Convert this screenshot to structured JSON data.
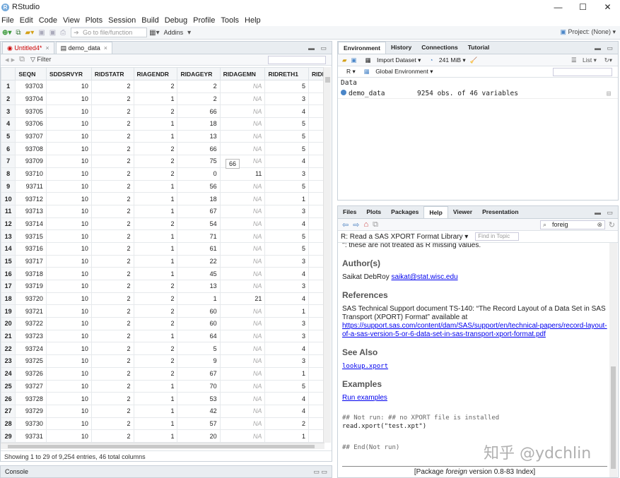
{
  "titlebar": {
    "title": "RStudio",
    "min": "—",
    "max": "☐",
    "close": "✕"
  },
  "menu": [
    "File",
    "Edit",
    "Code",
    "View",
    "Plots",
    "Session",
    "Build",
    "Debug",
    "Profile",
    "Tools",
    "Help"
  ],
  "toolbar": {
    "goto_placeholder": "Go to file/function",
    "addins": "Addins",
    "project": "Project: (None)"
  },
  "editor": {
    "tabs": [
      {
        "label": "Untitled4*",
        "active": false
      },
      {
        "label": "demo_data",
        "active": true
      }
    ],
    "filter": "Filter",
    "tooltip": "66",
    "columns": [
      "",
      "SEQN",
      "SDDSRVYR",
      "RIDSTATR",
      "RIAGENDR",
      "RIDAGEYR",
      "RIDAGEMN",
      "RIDRETH1",
      "RIDI"
    ],
    "rows": [
      [
        "1",
        "93703",
        "10",
        "2",
        "2",
        "2",
        "NA",
        "5"
      ],
      [
        "2",
        "93704",
        "10",
        "2",
        "1",
        "2",
        "NA",
        "3"
      ],
      [
        "3",
        "93705",
        "10",
        "2",
        "2",
        "66",
        "NA",
        "4"
      ],
      [
        "4",
        "93706",
        "10",
        "2",
        "1",
        "18",
        "NA",
        "5"
      ],
      [
        "5",
        "93707",
        "10",
        "2",
        "1",
        "13",
        "NA",
        "5"
      ],
      [
        "6",
        "93708",
        "10",
        "2",
        "2",
        "66",
        "NA",
        "5"
      ],
      [
        "7",
        "93709",
        "10",
        "2",
        "2",
        "75",
        "NA",
        "4"
      ],
      [
        "8",
        "93710",
        "10",
        "2",
        "2",
        "0",
        "11",
        "3"
      ],
      [
        "9",
        "93711",
        "10",
        "2",
        "1",
        "56",
        "NA",
        "5"
      ],
      [
        "10",
        "93712",
        "10",
        "2",
        "1",
        "18",
        "NA",
        "1"
      ],
      [
        "11",
        "93713",
        "10",
        "2",
        "1",
        "67",
        "NA",
        "3"
      ],
      [
        "12",
        "93714",
        "10",
        "2",
        "2",
        "54",
        "NA",
        "4"
      ],
      [
        "13",
        "93715",
        "10",
        "2",
        "1",
        "71",
        "NA",
        "5"
      ],
      [
        "14",
        "93716",
        "10",
        "2",
        "1",
        "61",
        "NA",
        "5"
      ],
      [
        "15",
        "93717",
        "10",
        "2",
        "1",
        "22",
        "NA",
        "3"
      ],
      [
        "16",
        "93718",
        "10",
        "2",
        "1",
        "45",
        "NA",
        "4"
      ],
      [
        "17",
        "93719",
        "10",
        "2",
        "2",
        "13",
        "NA",
        "3"
      ],
      [
        "18",
        "93720",
        "10",
        "2",
        "2",
        "1",
        "21",
        "4"
      ],
      [
        "19",
        "93721",
        "10",
        "2",
        "2",
        "60",
        "NA",
        "1"
      ],
      [
        "20",
        "93722",
        "10",
        "2",
        "2",
        "60",
        "NA",
        "3"
      ],
      [
        "21",
        "93723",
        "10",
        "2",
        "1",
        "64",
        "NA",
        "3"
      ],
      [
        "22",
        "93724",
        "10",
        "2",
        "2",
        "5",
        "NA",
        "4"
      ],
      [
        "23",
        "93725",
        "10",
        "2",
        "2",
        "9",
        "NA",
        "3"
      ],
      [
        "24",
        "93726",
        "10",
        "2",
        "2",
        "67",
        "NA",
        "1"
      ],
      [
        "25",
        "93727",
        "10",
        "2",
        "1",
        "70",
        "NA",
        "5"
      ],
      [
        "26",
        "93728",
        "10",
        "2",
        "1",
        "53",
        "NA",
        "4"
      ],
      [
        "27",
        "93729",
        "10",
        "2",
        "1",
        "42",
        "NA",
        "4"
      ],
      [
        "28",
        "93730",
        "10",
        "2",
        "1",
        "57",
        "NA",
        "2"
      ],
      [
        "29",
        "93731",
        "10",
        "2",
        "1",
        "20",
        "NA",
        "1"
      ]
    ],
    "status": "Showing 1 to 29 of 9,254 entries, 46 total columns"
  },
  "console": {
    "label": "Console"
  },
  "env": {
    "tabs": [
      "Environment",
      "History",
      "Connections",
      "Tutorial"
    ],
    "import": "Import Dataset",
    "memory": "241 MiB",
    "list": "List",
    "lang": "R",
    "scope": "Global Environment",
    "section": "Data",
    "item_name": "demo_data",
    "item_value": "9254 obs. of 46 variables"
  },
  "help": {
    "tabs": [
      "Files",
      "Plots",
      "Packages",
      "Help",
      "Viewer",
      "Presentation"
    ],
    "search_value": "foreig",
    "topic": "R: Read a SAS XPORT Format Library",
    "find_topic": "Find in Topic",
    "top_text": "'': these are not treated as R missing values.",
    "authors_h": "Author(s)",
    "author": "Saikat DebRoy",
    "author_email": "saikat@stat.wisc.edu",
    "refs_h": "References",
    "ref_text": "SAS Technical Support document TS-140: “The Record Layout of a Data Set in SAS Transport (XPORT) Format” available at",
    "ref_url": "https://support.sas.com/content/dam/SAS/support/en/technical-papers/record-layout-of-a-sas-version-5-or-6-data-set-in-sas-transport-xport-format.pdf",
    "seealso_h": "See Also",
    "seealso": "lookup.xport",
    "examples_h": "Examples",
    "run_examples": "Run examples",
    "code1": "## Not run: ## no XPORT file is installed",
    "code2": "read.xport(\"test.xpt\")",
    "code3": "## End(Not run)",
    "footer_pre": "[Package ",
    "footer_pkg": "foreign",
    "footer_mid": " version 0.8-83 ",
    "footer_index": "Index",
    "footer_post": "]"
  },
  "watermark": "知乎 @ydchlin"
}
